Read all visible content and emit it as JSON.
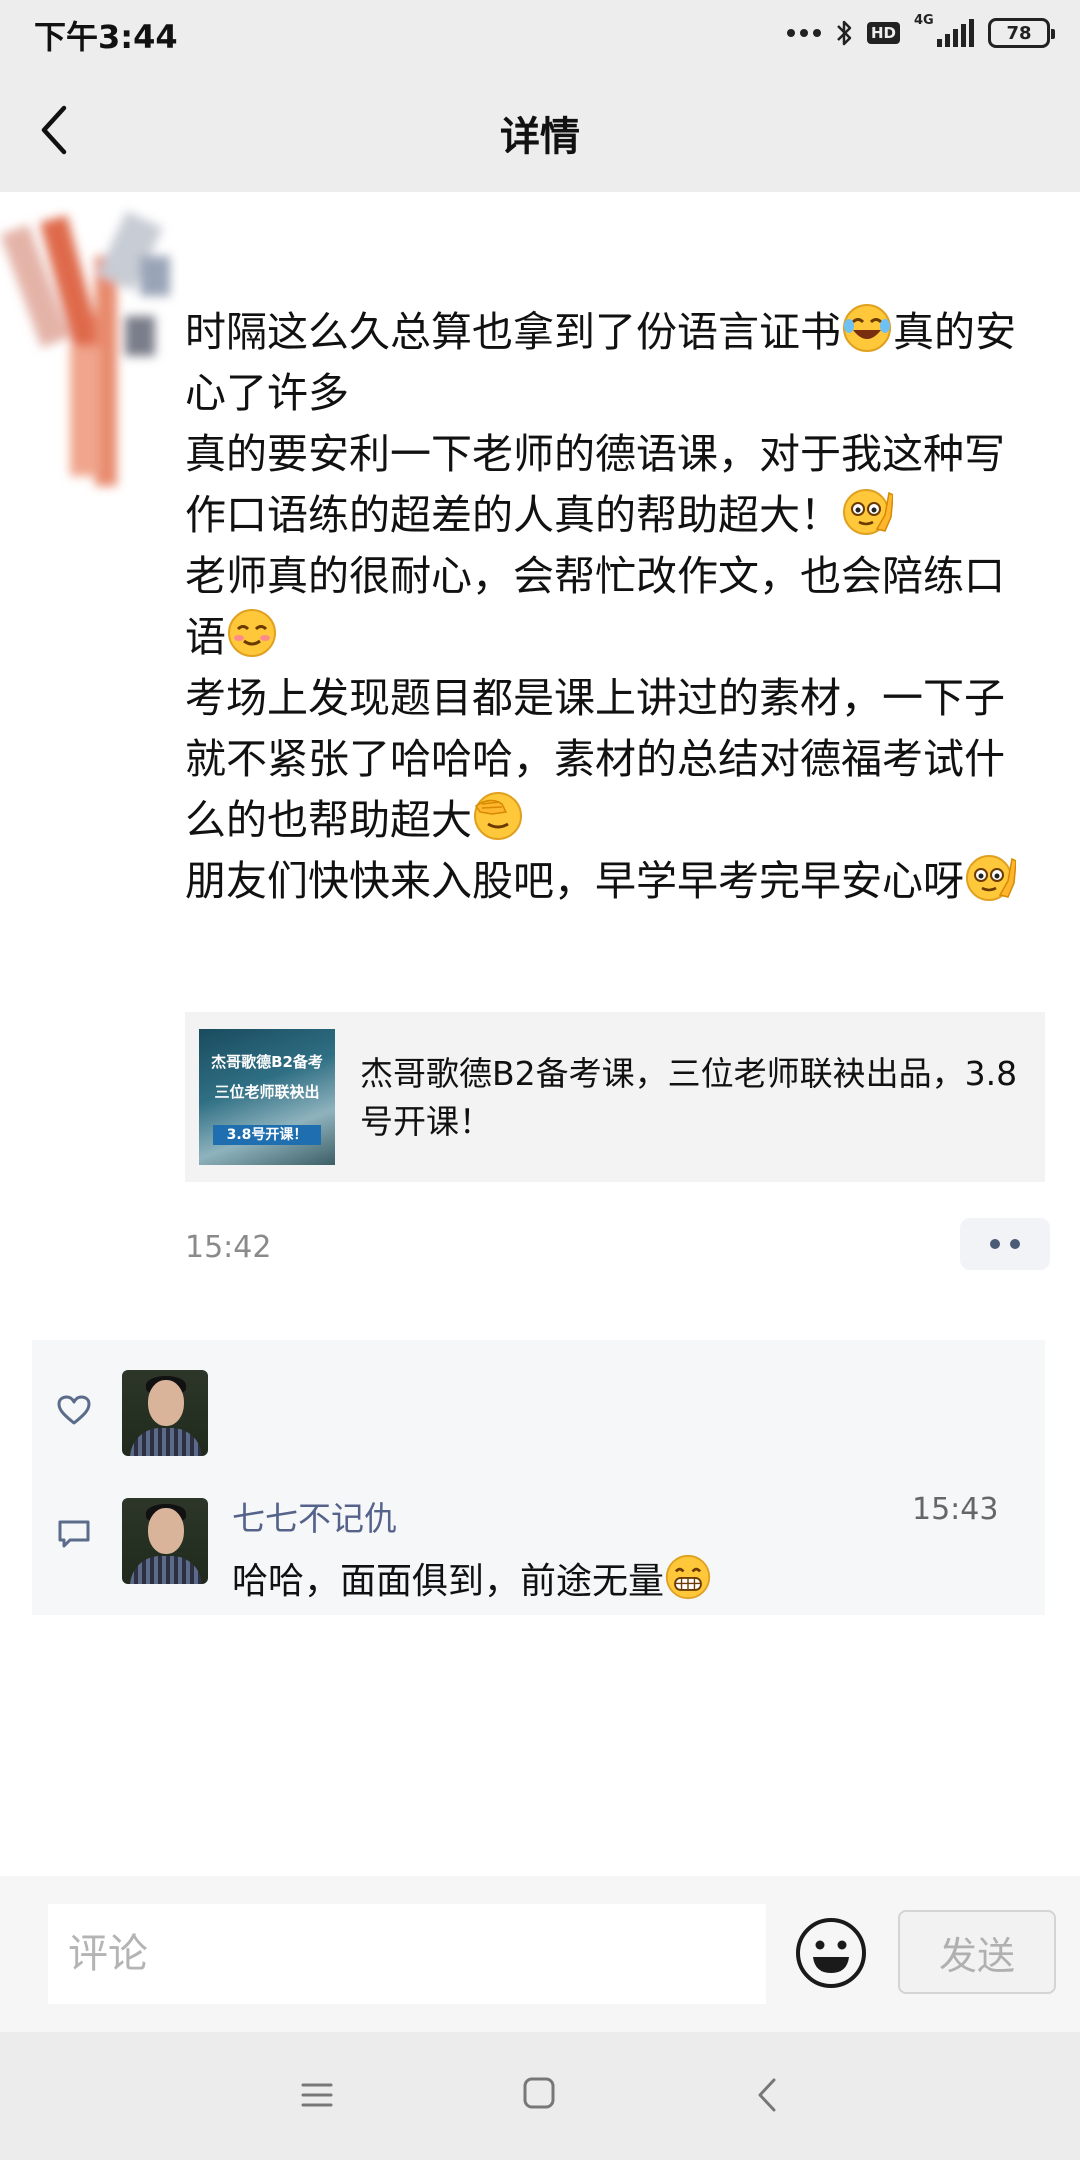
{
  "status_bar": {
    "time": "下午3:44",
    "network": "4G",
    "hd": "HD",
    "battery": "78"
  },
  "header": {
    "title": "详情"
  },
  "post": {
    "lines": [
      "时隔这么久总算也拿到了份语言证书",
      "真的安心了许多",
      "真的要安利一下老师的德语课，对于我这种写作口语练的超差的人真的帮助超大！",
      "老师真的很耐心，会帮忙改作文，也会陪练口语",
      "考场上发现题目都是课上讲过的素材，一下子就不紧张了哈哈哈，素材的总结对德福考试什么的也帮助超大",
      "朋友们快快来入股吧，早学早考完早安心呀"
    ],
    "link": {
      "title": "杰哥歌德B2备考课，三位老师联袂出品，3.8号开课！",
      "thumb_line1": "杰哥歌德B2备考",
      "thumb_line2": "三位老师联袂出",
      "thumb_badge": "3.8号开课！"
    },
    "time": "15:42"
  },
  "comments": [
    {
      "name": "七七不记仇",
      "time": "15:43",
      "text": "哈哈，面面俱到，前途无量"
    }
  ],
  "input": {
    "placeholder": "评论",
    "send_label": "发送"
  },
  "icons": {
    "back": "chevron-left-icon",
    "like": "heart-icon",
    "comment": "comment-icon",
    "emoji": "smiley-icon"
  },
  "colors": {
    "bar_bg": "#ededed",
    "name_color": "#55638a",
    "time_color": "#8a8a8a"
  }
}
